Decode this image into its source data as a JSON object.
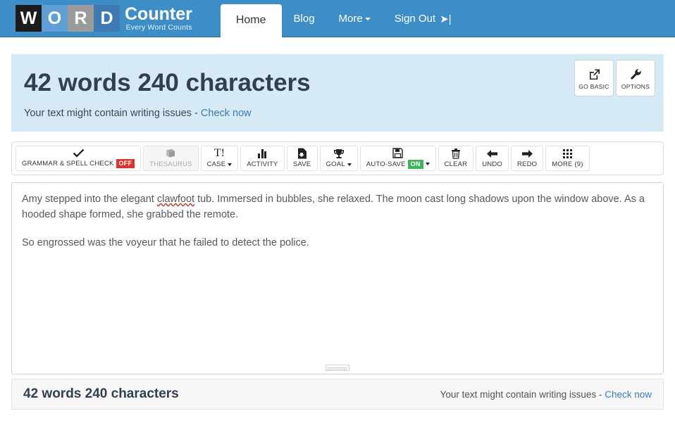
{
  "navbar": {
    "logo": {
      "blocks": [
        "W",
        "O",
        "R",
        "D"
      ],
      "title": "Counter",
      "subtitle": "Every Word Counts"
    },
    "items": [
      {
        "label": "Home",
        "active": true
      },
      {
        "label": "Blog",
        "active": false
      },
      {
        "label": "More",
        "active": false,
        "caret": true
      },
      {
        "label": "Sign Out",
        "active": false,
        "icon": "sign-out-icon"
      }
    ],
    "background_color": "#3d8dc6"
  },
  "stats_panel": {
    "title": "42 words 240 characters",
    "note_text": "Your text might contain writing issues -",
    "note_link": "Check now",
    "background_color": "#d6eaf6",
    "buttons": [
      {
        "label": "GO BASIC",
        "icon": "external-link-icon"
      },
      {
        "label": "OPTIONS",
        "icon": "wrench-icon"
      }
    ]
  },
  "toolbar": {
    "buttons": [
      {
        "label": "GRAMMAR & SPELL CHECK",
        "icon": "check-icon",
        "badge": "OFF",
        "badge_color": "#d9342b",
        "muted": false,
        "caret": false
      },
      {
        "label": "THESAURUS",
        "icon": "book-icon",
        "badge": "",
        "muted": true,
        "caret": false
      },
      {
        "label": "CASE",
        "icon": "text-case-icon",
        "badge": "",
        "muted": false,
        "caret": true
      },
      {
        "label": "ACTIVITY",
        "icon": "bar-chart-icon",
        "badge": "",
        "muted": false,
        "caret": false
      },
      {
        "label": "SAVE",
        "icon": "file-save-icon",
        "badge": "",
        "muted": false,
        "caret": false
      },
      {
        "label": "GOAL",
        "icon": "trophy-icon",
        "badge": "",
        "muted": false,
        "caret": true
      },
      {
        "label": "AUTO-SAVE",
        "icon": "floppy-disk-icon",
        "badge": "ON",
        "badge_color": "#3fb559",
        "muted": false,
        "caret": true
      },
      {
        "label": "CLEAR",
        "icon": "trash-icon",
        "badge": "",
        "muted": false,
        "caret": false
      },
      {
        "label": "UNDO",
        "icon": "arrow-left-icon",
        "badge": "",
        "muted": false,
        "caret": false
      },
      {
        "label": "REDO",
        "icon": "arrow-right-icon",
        "badge": "",
        "muted": false,
        "caret": false
      },
      {
        "label": "MORE (9)",
        "icon": "grid-icon",
        "badge": "",
        "muted": false,
        "caret": false
      }
    ]
  },
  "editor": {
    "paragraph1_a": "Amy stepped into the elegant ",
    "paragraph1_misspelled": "clawfoot",
    "paragraph1_b": " tub. Immersed in bubbles, she relaxed. The moon cast long shadows upon the window above. As a hooded shape formed, she grabbed the remote.",
    "paragraph2": "So engrossed was the voyeur that he failed to detect the police."
  },
  "footer": {
    "count": "42 words 240 characters",
    "note_text": "Your text might contain writing issues -",
    "note_link": "Check now"
  }
}
